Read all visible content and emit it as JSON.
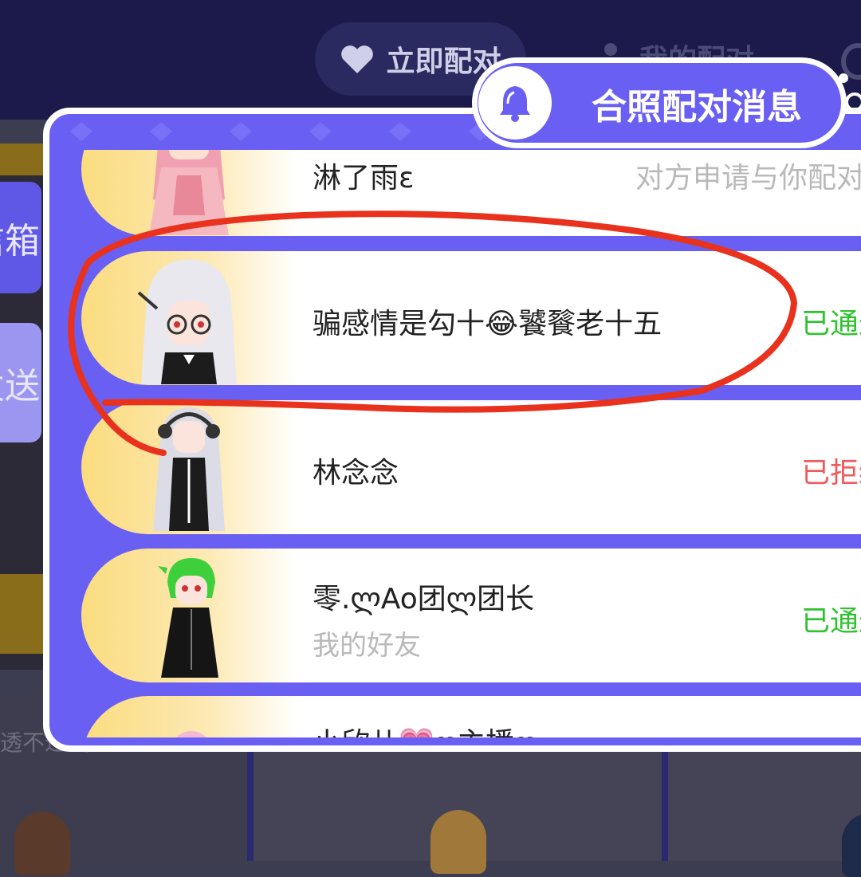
{
  "background": {
    "tabs": [
      {
        "label": "立即配对",
        "icon": "heart-icon"
      },
      {
        "label": "我的配对",
        "icon": "person-icon"
      }
    ],
    "left_buttons": [
      {
        "label": "信箱"
      },
      {
        "label": "发送"
      }
    ],
    "bottom_text": "透不过气"
  },
  "modal": {
    "title": "合照配对消息",
    "title_icon": "bell-icon",
    "accent_color": "#6a5ff3",
    "items": [
      {
        "name": "淋了雨ε",
        "subtitle": "",
        "status": "对方申请与你配对",
        "status_color": "#b9b9b9",
        "avatar": "pink-hair-girl"
      },
      {
        "name": "骗感情是勾十😂饕餮老十五",
        "subtitle": "",
        "status": "已通过",
        "status_color": "#2ec32e",
        "avatar": "white-hair-glasses"
      },
      {
        "name": "林念念",
        "subtitle": "",
        "status": "已拒绝",
        "status_color": "#f05a5a",
        "avatar": "silver-hair-headphones"
      },
      {
        "name": "零.ლAo团ლ团长",
        "subtitle": "我的好友",
        "status": "已通过",
        "status_color": "#2ec32e",
        "avatar": "green-hair"
      },
      {
        "name": "小欣儿💗ღ主播ღ",
        "subtitle": "",
        "status": "",
        "status_color": "#2ec32e",
        "avatar": "pink-hair"
      }
    ]
  },
  "annotation": {
    "type": "red-circle-highlight",
    "color": "#e8321e"
  }
}
